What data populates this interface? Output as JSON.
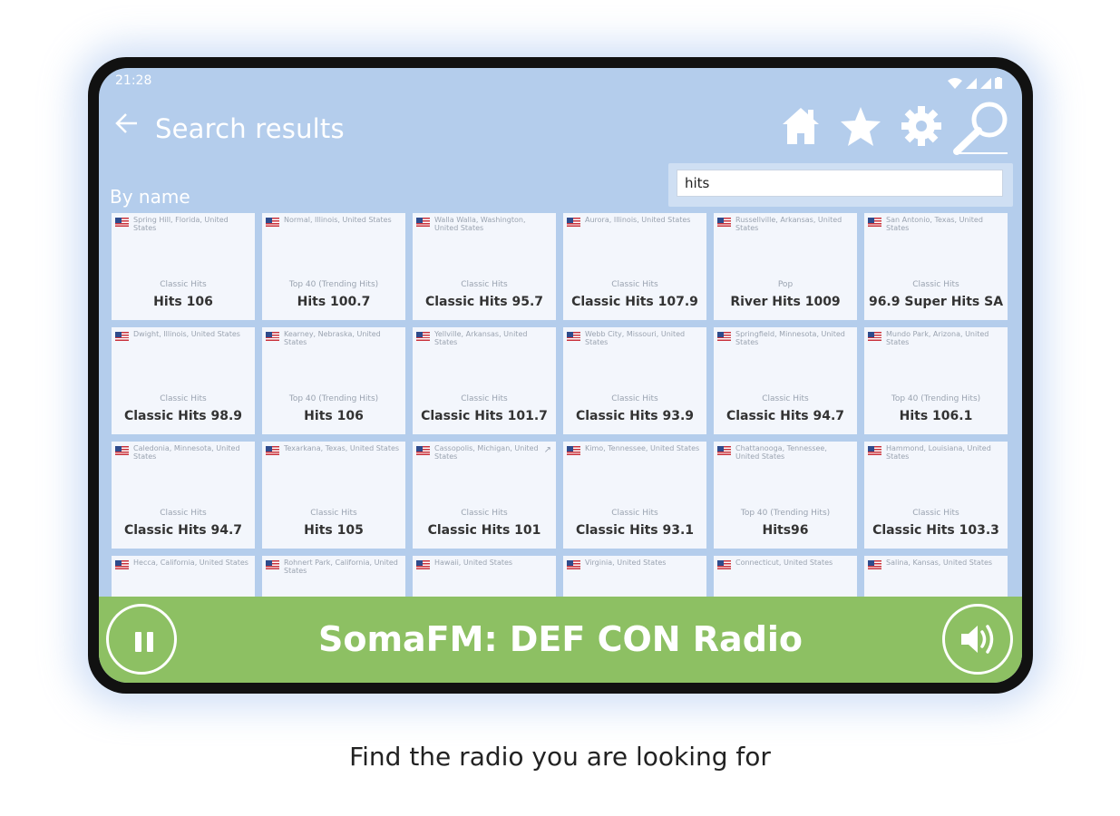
{
  "status": {
    "time": "21:28"
  },
  "appbar": {
    "title": "Search results",
    "back_icon": "arrow-left-icon"
  },
  "toolbar": {
    "icons": [
      "home-icon",
      "star-icon",
      "gear-icon",
      "search-icon"
    ]
  },
  "search": {
    "value": "hits"
  },
  "section": {
    "label": "By name"
  },
  "stations": [
    {
      "location": "Spring Hill, Florida, United States",
      "genre": "Classic Hits",
      "name": "Hits 106"
    },
    {
      "location": "Normal, Illinois, United States",
      "genre": "Top 40 (Trending Hits)",
      "name": "Hits 100.7"
    },
    {
      "location": "Walla Walla, Washington, United States",
      "genre": "Classic Hits",
      "name": "Classic Hits 95.7"
    },
    {
      "location": "Aurora, Illinois, United States",
      "genre": "Classic Hits",
      "name": "Classic Hits 107.9"
    },
    {
      "location": "Russellville, Arkansas, United States",
      "genre": "Pop",
      "name": "River Hits 1009"
    },
    {
      "location": "San Antonio, Texas, United States",
      "genre": "Classic Hits",
      "name": "96.9 Super Hits SA"
    },
    {
      "location": "Dwight, Illinois, United States",
      "genre": "Classic Hits",
      "name": "Classic Hits 98.9"
    },
    {
      "location": "Kearney, Nebraska, United States",
      "genre": "Top 40 (Trending Hits)",
      "name": "Hits 106"
    },
    {
      "location": "Yellville, Arkansas, United States",
      "genre": "Classic Hits",
      "name": "Classic Hits 101.7"
    },
    {
      "location": "Webb City, Missouri, United States",
      "genre": "Classic Hits",
      "name": "Classic Hits 93.9"
    },
    {
      "location": "Springfield, Minnesota, United States",
      "genre": "Classic Hits",
      "name": "Classic Hits 94.7"
    },
    {
      "location": "Mundo Park, Arizona, United States",
      "genre": "Top 40 (Trending Hits)",
      "name": "Hits 106.1"
    },
    {
      "location": "Caledonia, Minnesota, United States",
      "genre": "Classic Hits",
      "name": "Classic Hits 94.7"
    },
    {
      "location": "Texarkana, Texas, United States",
      "genre": "Classic Hits",
      "name": "Hits 105"
    },
    {
      "location": "Cassopolis, Michigan, United States",
      "genre": "Classic Hits",
      "name": "Classic Hits 101"
    },
    {
      "location": "Kimo, Tennessee, United States",
      "genre": "Classic Hits",
      "name": "Classic Hits 93.1"
    },
    {
      "location": "Chattanooga, Tennessee, United States",
      "genre": "Top 40 (Trending Hits)",
      "name": "Hits96"
    },
    {
      "location": "Hammond, Louisiana, United States",
      "genre": "Classic Hits",
      "name": "Classic Hits 103.3"
    },
    {
      "location": "Hecca, California, United States",
      "genre": "",
      "name": ""
    },
    {
      "location": "Rohnert Park, California, United States",
      "genre": "",
      "name": ""
    },
    {
      "location": "Hawaii, United States",
      "genre": "",
      "name": ""
    },
    {
      "location": "Virginia, United States",
      "genre": "",
      "name": ""
    },
    {
      "location": "Connecticut, United States",
      "genre": "",
      "name": ""
    },
    {
      "location": "Salina, Kansas, United States",
      "genre": "",
      "name": ""
    }
  ],
  "player": {
    "now_playing": "SomaFM: DEF CON Radio",
    "pause_icon": "pause-icon",
    "volume_icon": "volume-icon"
  },
  "caption": "Find the radio you are looking for"
}
